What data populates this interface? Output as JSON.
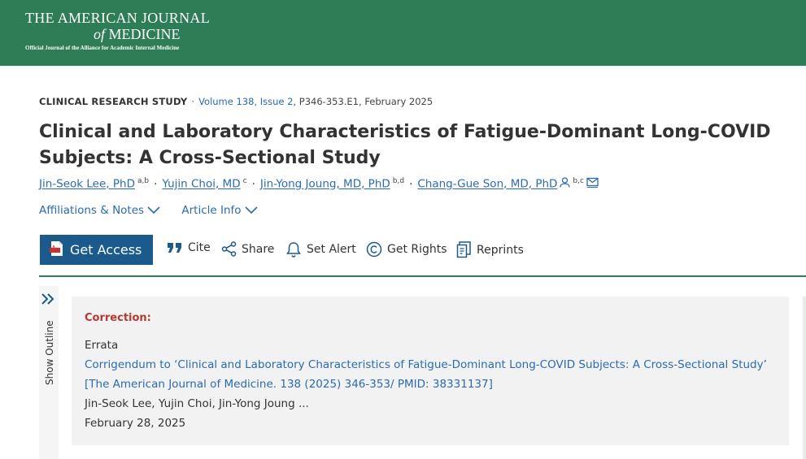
{
  "header": {
    "journal_line1": "THE AMERICAN JOURNAL",
    "journal_of": "of",
    "journal_line2": "MEDICINE",
    "tagline": "Official Journal of the Alliance for Academic Internal Medicine"
  },
  "article": {
    "type": "CLINICAL RESEARCH STUDY",
    "separator": "·",
    "volume": "Volume 138, Issue 2",
    "pages_date": ", P346-353.E1, February 2025",
    "title": "Clinical and Laboratory Characteristics of Fatigue-Dominant Long-COVID Subjects: A Cross-Sectional Study",
    "authors": [
      {
        "name": "Jin-Seok Lee, PhD",
        "sup": "a,b"
      },
      {
        "name": "Yujin Choi, MD",
        "sup": "c"
      },
      {
        "name": "Jin-Yong Joung, MD, PhD",
        "sup": "b,d"
      },
      {
        "name": "Chang-Gue Son, MD, PhD",
        "sup": "b,c"
      }
    ]
  },
  "links": {
    "affiliations": "Affiliations & Notes",
    "article_info": "Article Info"
  },
  "toolbar": {
    "get_access": "Get Access",
    "cite": "Cite",
    "share": "Share",
    "set_alert": "Set Alert",
    "get_rights": "Get Rights",
    "reprints": "Reprints"
  },
  "sidebar": {
    "outline_label": "Show Outline"
  },
  "correction": {
    "heading": "Correction:",
    "label": "Errata",
    "link_line1": "Corrigendum to ‘Clinical and Laboratory Characteristics of Fatigue-Dominant Long-COVID Subjects: A Cross-Sectional Study’",
    "link_line2": "[The American Journal of Medicine. 138 (2025) 346-353/ PMID: 38331137]",
    "authors": "Jin-Seok Lee, Yujin Choi, Jin-Yong Joung ...",
    "date": "February 28, 2025"
  },
  "colors": {
    "brand_green": "#2e7d57",
    "access_blue": "#1b5a8c",
    "link_blue": "#2a6bb5",
    "correction_red": "#b23a2e"
  }
}
